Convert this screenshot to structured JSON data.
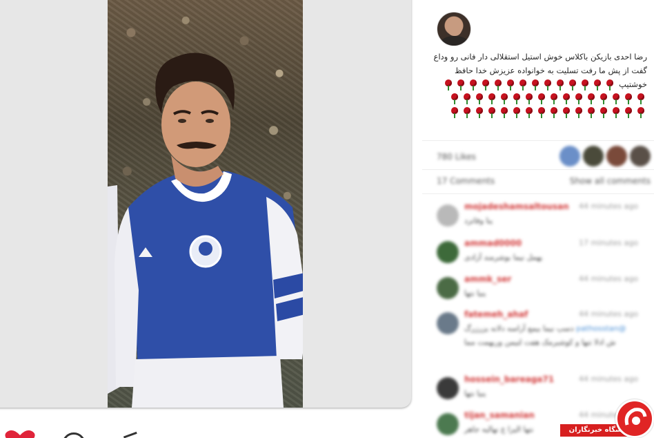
{
  "post": {
    "caption_lines": [
      "رضا احدی بازیکن باکلاس خوش استیل استقلالی دار فانی رو وداع",
      "گفت از پش ما رفت تسلیت به خوانواده عزیزش خدا حافظ",
      "خوشتیپ"
    ],
    "rose_count": 46,
    "likes_label": "780 Likes",
    "comments_label": "17 Comments",
    "show_all_label": "Show all comments"
  },
  "comments": [
    {
      "user": "mojadeshamsaltousan",
      "time": "44 minutes ago",
      "text": "ینا وفاتزد"
    },
    {
      "user": "ammad0000",
      "time": "17 minutes ago",
      "text": "یهمل نیما بوشرمند آزادی"
    },
    {
      "user": "ammk_ser",
      "time": "44 minutes ago",
      "text": "ینیا نتها"
    },
    {
      "user": "fatemeh_ahaf",
      "time": "44 minutes ago",
      "mention": "@pathosstan",
      "text": "دسپ نیما بیمع آراسه دلانه یزرزرگ ش ادلا تنها و کوشبرمک هفت لنیمن وربهمت مما"
    },
    {
      "user": "hossein_bareaga71",
      "time": "44 minutes ago",
      "text": "ینیا نتها"
    },
    {
      "user": "tijan_samanian",
      "time": "44 minutes ago",
      "text": "نتها الیزا ع نهالیه جاهر"
    }
  ],
  "watermark": {
    "text": "باشگاه خبرنگاران"
  },
  "colors": {
    "rose": "#c6121f",
    "username": "#d23a3a",
    "mention": "#4a8fd6",
    "watermark": "#d71f1f"
  }
}
